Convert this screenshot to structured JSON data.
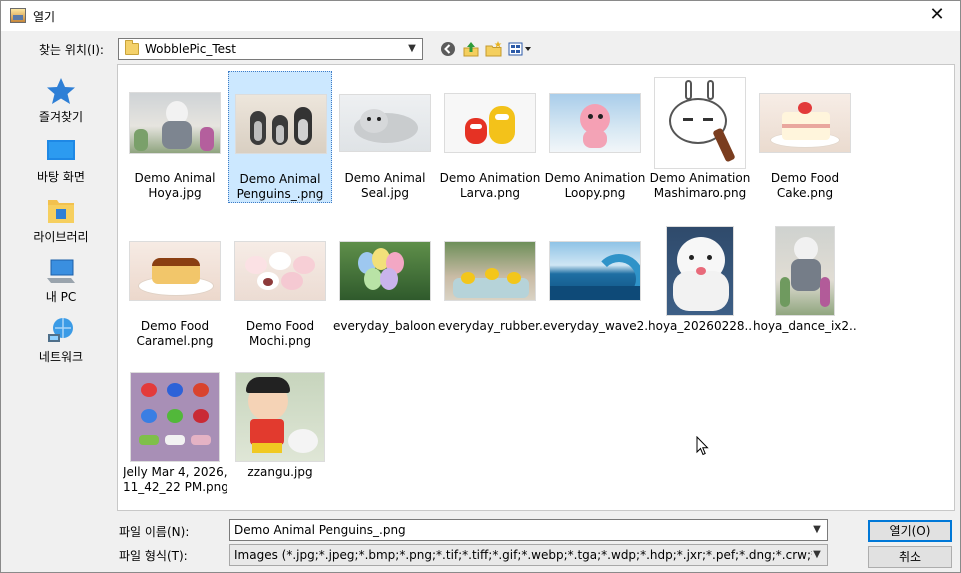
{
  "window": {
    "title": "열기",
    "close": "✕"
  },
  "location": {
    "label": "찾는 위치(I):",
    "value": "WobblePic_Test"
  },
  "toolbar": {
    "back": "back-icon",
    "up": "up-folder-icon",
    "new_folder": "new-folder-icon",
    "view": "view-menu-icon"
  },
  "places": [
    {
      "label": "즐겨찾기",
      "icon": "star-icon"
    },
    {
      "label": "바탕 화면",
      "icon": "desktop-icon"
    },
    {
      "label": "라이브러리",
      "icon": "library-icon"
    },
    {
      "label": "내 PC",
      "icon": "computer-icon"
    },
    {
      "label": "네트워크",
      "icon": "network-icon"
    }
  ],
  "files": [
    {
      "line1": "Demo Animal",
      "line2": "Hoya.jpg"
    },
    {
      "line1": "Demo Animal",
      "line2": "Penguins_.png"
    },
    {
      "line1": "Demo Animal",
      "line2": "Seal.jpg"
    },
    {
      "line1": "Demo Animation",
      "line2": "Larva.png"
    },
    {
      "line1": "Demo Animation",
      "line2": "Loopy.png"
    },
    {
      "line1": "Demo Animation",
      "line2": "Mashimaro.png"
    },
    {
      "line1": "Demo Food",
      "line2": "Cake.png"
    },
    {
      "line1": "Demo Food",
      "line2": "Caramel.png"
    },
    {
      "line1": "Demo Food",
      "line2": "Mochi.png"
    },
    {
      "line1": "everyday_baloon...",
      "line2": ""
    },
    {
      "line1": "everyday_rubber...",
      "line2": ""
    },
    {
      "line1": "everyday_wave2...",
      "line2": ""
    },
    {
      "line1": "hoya_20260228...",
      "line2": ""
    },
    {
      "line1": "hoya_dance_ix2...",
      "line2": ""
    },
    {
      "line1": "Jelly Mar 4, 2026,",
      "line2": "11_42_22 PM.png"
    },
    {
      "line1": "zzangu.jpg",
      "line2": ""
    }
  ],
  "selected_file": "Demo Animal Penguins_.png",
  "filename": {
    "label": "파일 이름(N):",
    "value": "Demo Animal Penguins_.png"
  },
  "filetype": {
    "label": "파일 형식(T):",
    "value": "Images (*.jpg;*.jpeg;*.bmp;*.png;*.tif;*.tiff;*.gif;*.webp;*.tga;*.wdp;*.hdp;*.jxr;*.pef;*.dng;*.crw;*.nef"
  },
  "buttons": {
    "open": "열기(O)",
    "cancel": "취소"
  }
}
